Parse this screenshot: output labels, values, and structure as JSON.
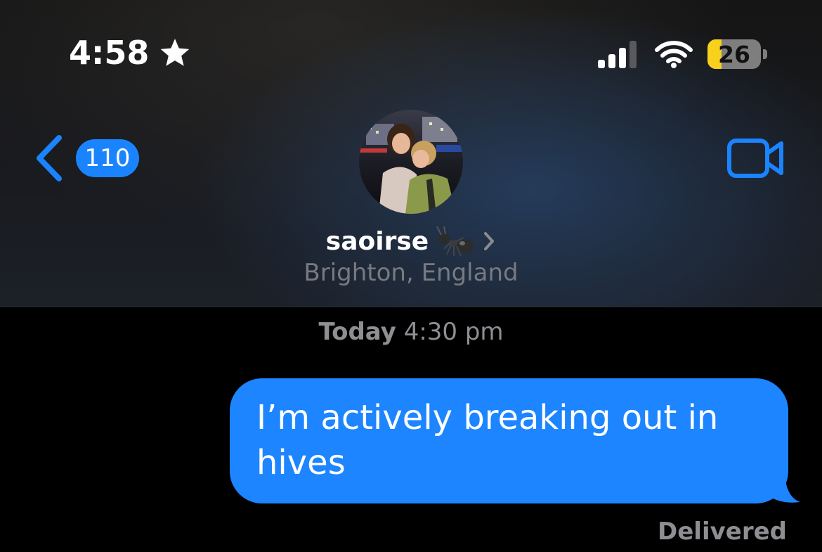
{
  "status_bar": {
    "time": "4:58",
    "battery_percent": "26",
    "battery_level": 0.26,
    "cellular_bars": 3,
    "icons": [
      "star-icon",
      "signal-icon",
      "wifi-icon",
      "battery-icon"
    ]
  },
  "nav": {
    "unread_count": "110",
    "contact_name": "saoirse",
    "contact_emoji": "ant-icon",
    "contact_location": "Brighton, England",
    "icons": [
      "back-chevron-icon",
      "video-camera-icon",
      "chevron-right-icon"
    ]
  },
  "conversation": {
    "timestamp_day": "Today",
    "timestamp_time": "4:30 pm",
    "messages": [
      {
        "text": "I’m actively breaking out in hives",
        "sender": "me"
      }
    ],
    "status": "Delivered"
  },
  "colors": {
    "accent": "#1a84ff",
    "bubble_outgoing": "#1c85ff",
    "secondary_text": "#8e8e93",
    "battery_fill": "#f7d11c"
  }
}
